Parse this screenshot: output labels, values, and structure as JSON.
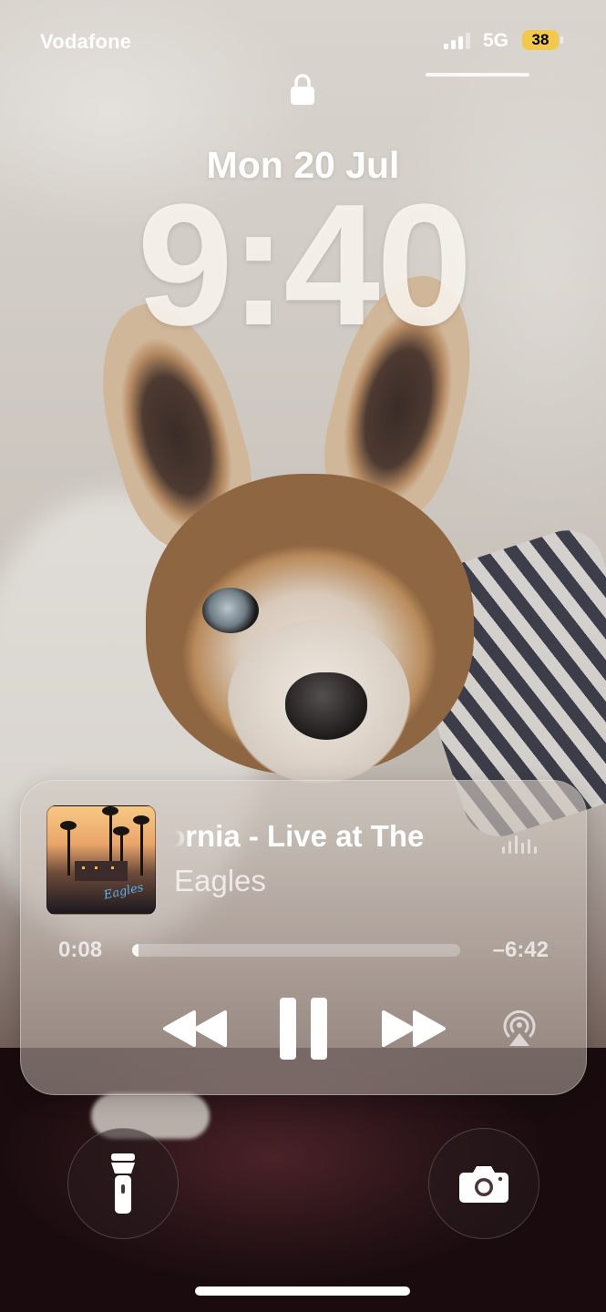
{
  "status_bar": {
    "carrier": "Vodafone",
    "network": "5G",
    "battery_level": "38",
    "battery_color": "#f2c94c"
  },
  "lock_screen": {
    "date": "Mon 20 Jul",
    "time": "9:40",
    "lock_icon": "lock-icon"
  },
  "now_playing": {
    "title_visible": "ornia - Live at The",
    "artist": "Eagles",
    "elapsed": "0:08",
    "remaining": "–6:42",
    "progress_fraction": 0.02,
    "album_art_text": "Eagles",
    "controls": [
      "backward-icon",
      "pause-icon",
      "forward-icon",
      "airplay-icon"
    ]
  },
  "quick_actions": {
    "left": "flashlight-icon",
    "right": "camera-icon"
  }
}
